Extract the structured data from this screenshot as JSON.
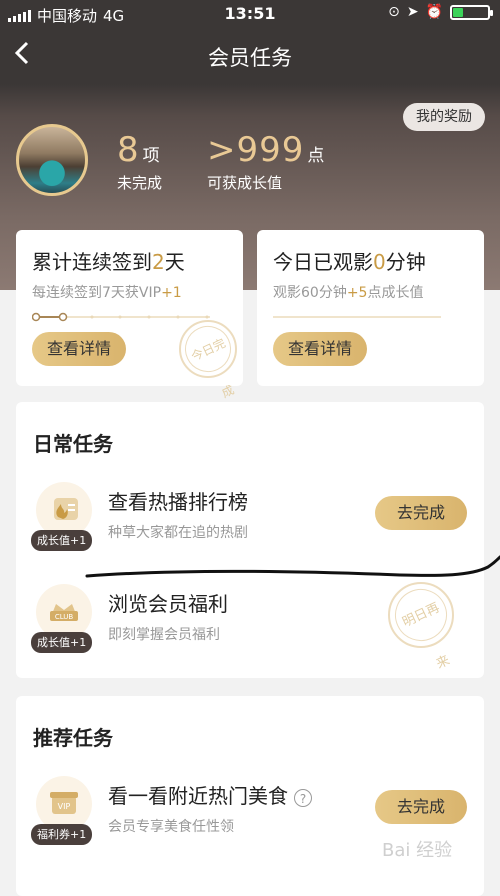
{
  "status_bar": {
    "carrier": "中国移动",
    "network": "4G",
    "time": "13:51"
  },
  "nav": {
    "title": "会员任务"
  },
  "summary": {
    "reward_button": "我的奖励",
    "incomplete_count": "8",
    "incomplete_unit": "项",
    "incomplete_label": "未完成",
    "growth_value": ">999",
    "growth_unit": "点",
    "growth_label": "可获成长值"
  },
  "checkin_card": {
    "title_prefix": "累计连续签到",
    "days": "2",
    "title_suffix": "天",
    "subtitle": "每连续签到7天获VIP",
    "subtitle_bonus": "+1",
    "button": "查看详情",
    "stamp": "今日完成",
    "progress_days": 2,
    "total_days": 7
  },
  "watch_card": {
    "title_prefix": "今日已观影",
    "minutes": "0",
    "title_suffix": "分钟",
    "subtitle_prefix": "观影60分钟",
    "subtitle_bonus": "+5",
    "subtitle_suffix": "点成长值",
    "button": "查看详情"
  },
  "daily_tasks": {
    "title": "日常任务",
    "items": [
      {
        "name": "查看热播排行榜",
        "desc": "种草大家都在追的热剧",
        "badge": "成长值+1",
        "action": "去完成"
      },
      {
        "name": "浏览会员福利",
        "desc": "即刻掌握会员福利",
        "badge": "成长值+1",
        "stamp": "明日再来",
        "icon_text": "CLUB"
      }
    ]
  },
  "recommended_tasks": {
    "title": "推荐任务",
    "items": [
      {
        "name": "看一看附近热门美食",
        "desc": "会员专享美食任性领",
        "badge": "福利券+1",
        "action": "去完成",
        "icon_text": "VIP"
      }
    ]
  },
  "watermark": "Bai 经验",
  "colors": {
    "gold": "#c99b45",
    "button_gold": "#e0bf7c",
    "header_dark": "#3b3736"
  }
}
